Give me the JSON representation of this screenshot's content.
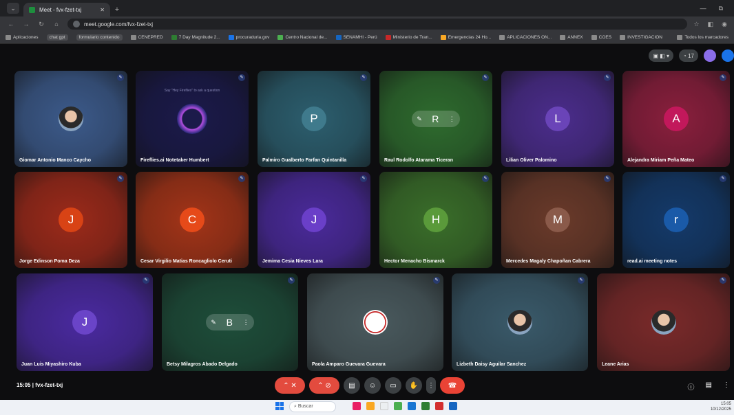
{
  "browser": {
    "tab_title": "Meet - fvx-fzet-txj",
    "url": "meet.google.com/fvx-fzet-txj",
    "bookmarks": [
      "Aplicaciones",
      "chat gpt",
      "formulario contenido",
      "CENEPRED",
      "7 Day Magnitude 2...",
      "procuraduria.gov",
      "Centro Nacional de...",
      "SENAMHI - Perú",
      "Ministerio de Tran...",
      "Emergencias 24 Ho...",
      "APLICACIONES ON...",
      "ANNEX",
      "COES",
      "INVESTIGACION",
      "Todos los marcadores"
    ]
  },
  "meeting": {
    "code": "fvx-fzet-txj",
    "time": "15:05",
    "participants": [
      {
        "name": "Giomar Antonio Manco Caycho",
        "initial": "",
        "bg": "#3c5a8a",
        "type": "photo"
      },
      {
        "name": "Fireflies.ai Notetaker Humbert",
        "initial": "",
        "bg": "#1b1a4a",
        "type": "fireflies"
      },
      {
        "name": "Palmiro Gualberto Farfan Quintanilla",
        "initial": "P",
        "bg": "#2c5e6e",
        "avatar": "#3f7a8c"
      },
      {
        "name": "Raul Rodolfo Atarama Ticeran",
        "initial": "R",
        "bg": "#2e6b2e",
        "avatar": "#4c8a3c",
        "type": "hover"
      },
      {
        "name": "Lilian Oliver Palomino",
        "initial": "L",
        "bg": "#4b2d8c",
        "avatar": "#6a44b8"
      },
      {
        "name": "Alejandra Miriam Peña Mateo",
        "initial": "A",
        "bg": "#8a1f3d",
        "avatar": "#c2185b"
      },
      {
        "name": "Jorge Edinson Poma Deza",
        "initial": "J",
        "bg": "#9c2a1a",
        "avatar": "#d84315"
      },
      {
        "name": "Cesar Virgilio Matias Roncagliolo Ceruti",
        "initial": "C",
        "bg": "#a33418",
        "avatar": "#e64a19"
      },
      {
        "name": "Jemima Cesia Nieves Lara",
        "initial": "J",
        "bg": "#4a2a9a",
        "avatar": "#6a3fc8"
      },
      {
        "name": "Hector Menacho Bismarck",
        "initial": "H",
        "bg": "#3a6e2a",
        "avatar": "#5a9a3a"
      },
      {
        "name": "Mercedes Magaly Chapoñan Cabrera",
        "initial": "M",
        "bg": "#6a3a2a",
        "avatar": "#8a5a4a"
      },
      {
        "name": "read.ai meeting notes",
        "initial": "r",
        "bg": "#143a6a",
        "avatar": "#1a5aa8"
      },
      {
        "name": "Juan Luis Miyashiro Kuba",
        "initial": "J",
        "bg": "#4a2aa0",
        "avatar": "#6a44c8"
      },
      {
        "name": "Betsy Milagros Abado Delgado",
        "initial": "B",
        "bg": "#1e4e3a",
        "avatar": "#2e6e54",
        "type": "hover"
      },
      {
        "name": "Paola Amparo Guevara Guevara",
        "initial": "",
        "bg": "#4a5a5e",
        "type": "logo"
      },
      {
        "name": "Lizbeth Daisy Aguilar Sanchez",
        "initial": "",
        "bg": "#3a5a6a",
        "type": "photo"
      },
      {
        "name": "Leane Arias",
        "initial": "",
        "bg": "#7a2a2a",
        "type": "photo"
      }
    ],
    "fireflies_text": "Say \"Hey Fireflies\" to ask a question"
  },
  "taskbar": {
    "search_placeholder": "Buscar",
    "time": "15:05",
    "date": "10/12/2025"
  }
}
